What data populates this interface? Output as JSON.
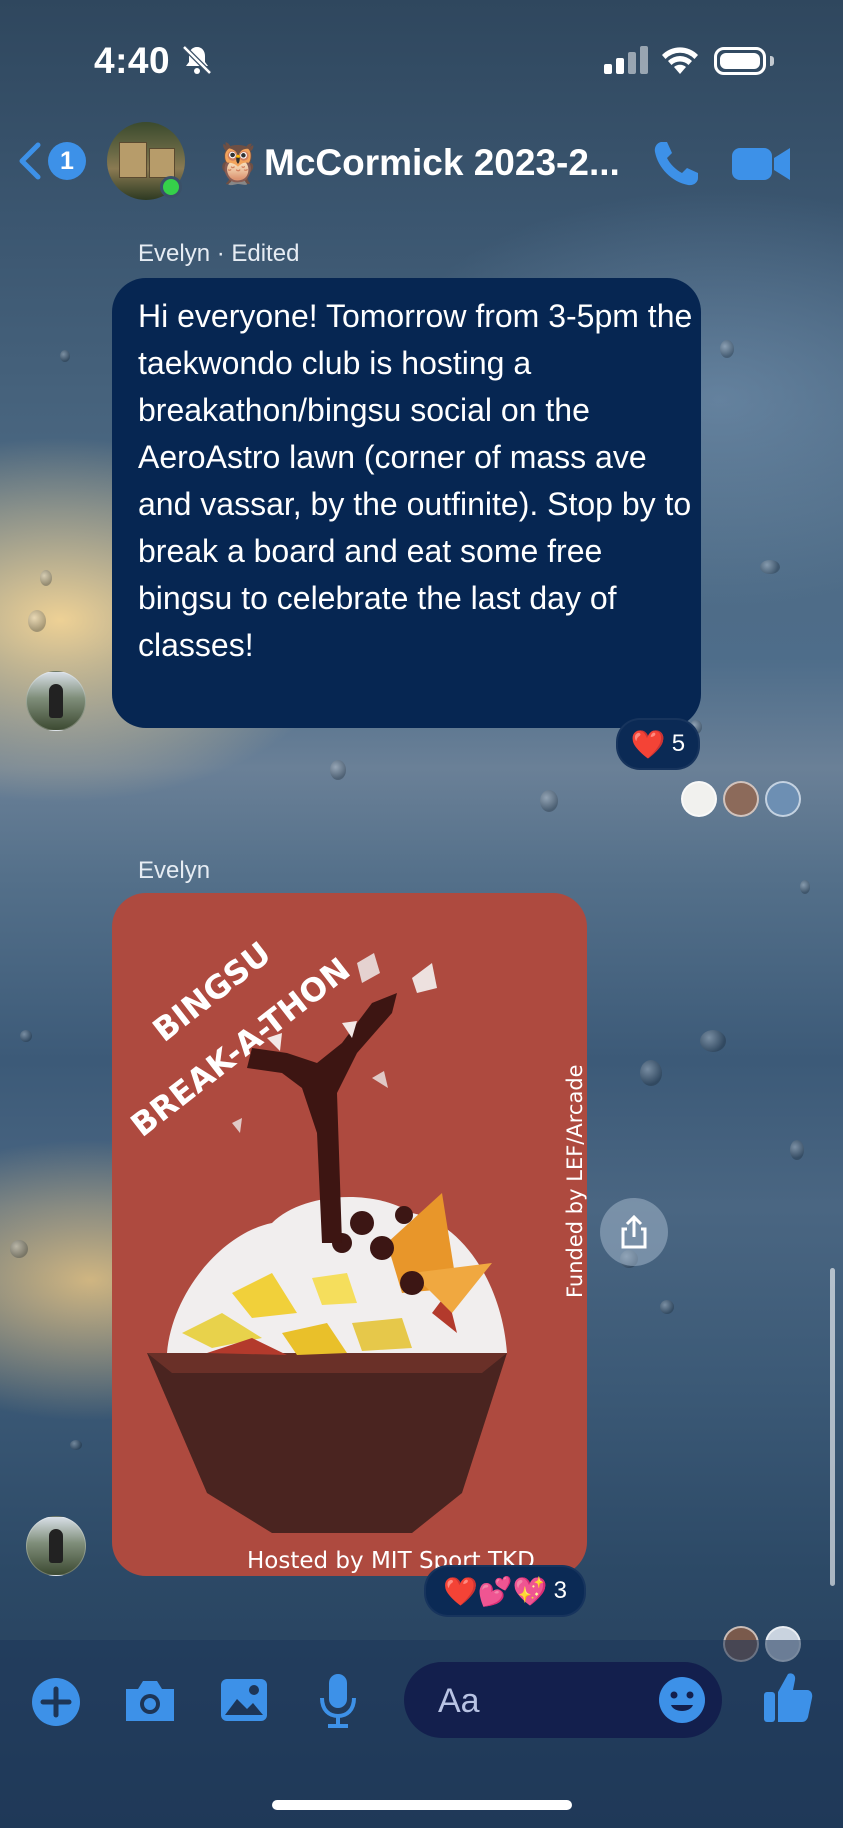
{
  "status_bar": {
    "time": "4:40"
  },
  "header": {
    "back_badge": "1",
    "owl_emoji": "🦉",
    "title": "McCormick 2023-2..."
  },
  "messages": [
    {
      "sender_line": "Evelyn · Edited",
      "text": "Hi everyone! Tomorrow from 3-5pm the taekwondo club is hosting a breakathon/bingsu social on the AeroAstro lawn (corner of mass ave and vassar, by the outfinite). Stop by to break a board and eat some free bingsu to celebrate the last day of classes!",
      "reaction": {
        "emoji": "❤️",
        "count": "5"
      }
    },
    {
      "sender_line": "Evelyn",
      "poster": {
        "title_line1": "BINGSU",
        "title_line2": "BREAK-A-THON",
        "side_text": "Funded by LEF/Arcade",
        "bottom_text": "Hosted by MIT Sport TKD"
      },
      "reaction": {
        "emoji": "❤️💕💖",
        "count": "3"
      }
    }
  ],
  "composer": {
    "placeholder": "Aa"
  },
  "colors": {
    "bubble": "#062652",
    "accent": "#3d91e8",
    "poster_bg": "#ae4a3f",
    "online": "#35d04a"
  }
}
